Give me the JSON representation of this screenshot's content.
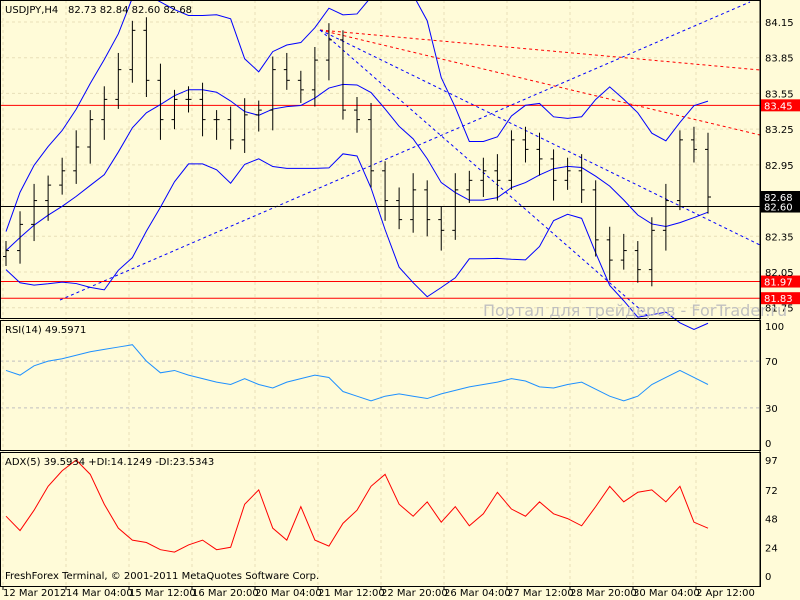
{
  "header": {
    "symbol": "USDJPY,H4",
    "ohlc": "82.73 82.84 82.60 82.68"
  },
  "rsi_label": "RSI(14) 49.5971",
  "adx_label": "ADX(5) 39.5934 +DI:14.1249 -DI:23.5343",
  "copyright": "FreshForex Terminal, © 2001-2011 MetaQuotes Software Corp.",
  "watermark": "Портал для трейдеров - ForTrader.ru",
  "colors": {
    "bg": "#fffbd8",
    "bars": "#000000",
    "bands": "#0000ff",
    "rsi": "#1e90ff",
    "adx": "#ff0000",
    "level": "#ff0000"
  },
  "chart_data": [
    {
      "type": "line",
      "title": "USDJPY,H4",
      "ylim": [
        81.75,
        84.25
      ],
      "price_ticks": [
        "84.15",
        "83.85",
        "83.55",
        "83.25",
        "82.95",
        "82.35",
        "82.05",
        "81.75"
      ],
      "x_ticks": [
        "12 Mar 2012",
        "14 Mar 04:00",
        "15 Mar 12:00",
        "16 Mar 20:00",
        "20 Mar 04:00",
        "21 Mar 12:00",
        "22 Mar 20:00",
        "26 Mar 04:00",
        "27 Mar 12:00",
        "28 Mar 20:00",
        "30 Mar 04:00",
        "2 Apr 12:00"
      ],
      "levels": [
        {
          "price": 83.45,
          "label": "83.45",
          "color": "#ff0000"
        },
        {
          "price": 81.97,
          "label": "81.97",
          "color": "#ff0000"
        },
        {
          "price": 81.83,
          "label": "81.83",
          "color": "#ff0000"
        },
        {
          "price": 82.6,
          "label": "82.60",
          "color": "#000000"
        },
        {
          "price": 82.68,
          "label": "82.68",
          "color": "#000000"
        }
      ],
      "close": [
        82.23,
        82.45,
        82.65,
        82.78,
        82.9,
        83.1,
        83.33,
        83.5,
        83.75,
        84.08,
        83.66,
        83.33,
        83.5,
        83.5,
        83.33,
        83.33,
        83.16,
        83.37,
        83.41,
        83.75,
        83.66,
        83.58,
        83.83,
        84.0,
        83.41,
        83.33,
        82.9,
        82.65,
        82.49,
        82.74,
        82.49,
        82.4,
        82.74,
        82.82,
        82.9,
        82.82,
        83.16,
        83.08,
        83.0,
        82.82,
        82.9,
        82.74,
        82.32,
        82.15,
        82.23,
        82.07,
        82.4,
        82.65,
        83.16,
        83.08,
        82.68
      ]
    },
    {
      "type": "line",
      "title": "RSI(14) 49.5971",
      "ylim": [
        0,
        100
      ],
      "levels": [
        70,
        30
      ],
      "ticks": [
        "100",
        "70",
        "30",
        "0"
      ],
      "values": [
        62,
        58,
        66,
        70,
        72,
        75,
        78,
        80,
        82,
        84,
        70,
        60,
        62,
        58,
        55,
        52,
        50,
        55,
        50,
        47,
        52,
        55,
        58,
        56,
        44,
        40,
        36,
        40,
        42,
        40,
        38,
        42,
        45,
        48,
        50,
        52,
        55,
        53,
        48,
        47,
        50,
        52,
        46,
        40,
        36,
        40,
        50,
        56,
        62,
        56,
        50
      ]
    },
    {
      "type": "line",
      "title": "ADX(5) 39.5934 +DI:14.1249 -DI:23.5343",
      "ylim": [
        0,
        97
      ],
      "ticks": [
        "97",
        "72",
        "48",
        "24",
        "0"
      ],
      "values": [
        50,
        38,
        55,
        75,
        88,
        97,
        85,
        60,
        40,
        30,
        28,
        22,
        20,
        26,
        30,
        22,
        24,
        60,
        72,
        40,
        30,
        58,
        30,
        25,
        44,
        55,
        75,
        85,
        60,
        50,
        62,
        45,
        58,
        42,
        52,
        70,
        56,
        50,
        62,
        52,
        48,
        42,
        58,
        75,
        62,
        70,
        72,
        62,
        75,
        45,
        40
      ]
    }
  ]
}
